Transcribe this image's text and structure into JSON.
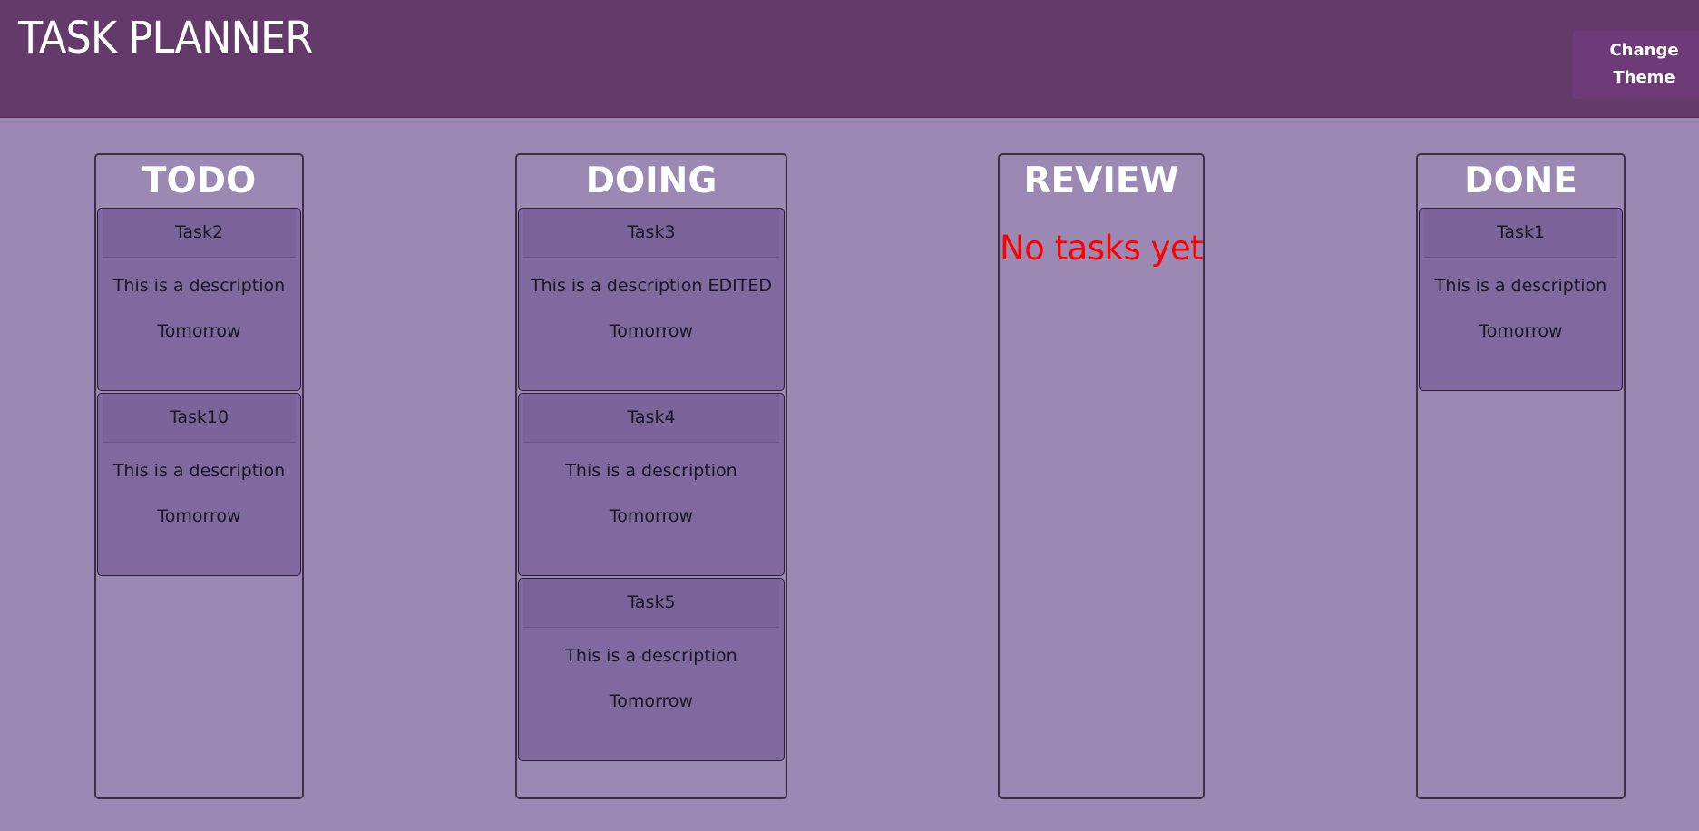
{
  "header": {
    "title": "TASK PLANNER",
    "theme_button_label": "Change Theme"
  },
  "columns": [
    {
      "title": "TODO",
      "tasks": [
        {
          "name": "Task2",
          "description": "This is a description",
          "due": "Tomorrow"
        },
        {
          "name": "Task10",
          "description": "This is a description",
          "due": "Tomorrow"
        }
      ]
    },
    {
      "title": "DOING",
      "tasks": [
        {
          "name": "Task3",
          "description": "This is a description EDITED",
          "due": "Tomorrow"
        },
        {
          "name": "Task4",
          "description": "This is a description",
          "due": "Tomorrow"
        },
        {
          "name": "Task5",
          "description": "This is a description",
          "due": "Tomorrow"
        }
      ]
    },
    {
      "title": "REVIEW",
      "empty_message": "No tasks yet",
      "tasks": []
    },
    {
      "title": "DONE",
      "tasks": [
        {
          "name": "Task1",
          "description": "This is a description",
          "due": "Tomorrow"
        }
      ]
    }
  ],
  "colors": {
    "header_bg": "#633a69",
    "page_bg": "#9b88b3",
    "card_bg": "#7f699f",
    "empty_message": "#ff0000",
    "button_bg": "#6f3a78"
  }
}
